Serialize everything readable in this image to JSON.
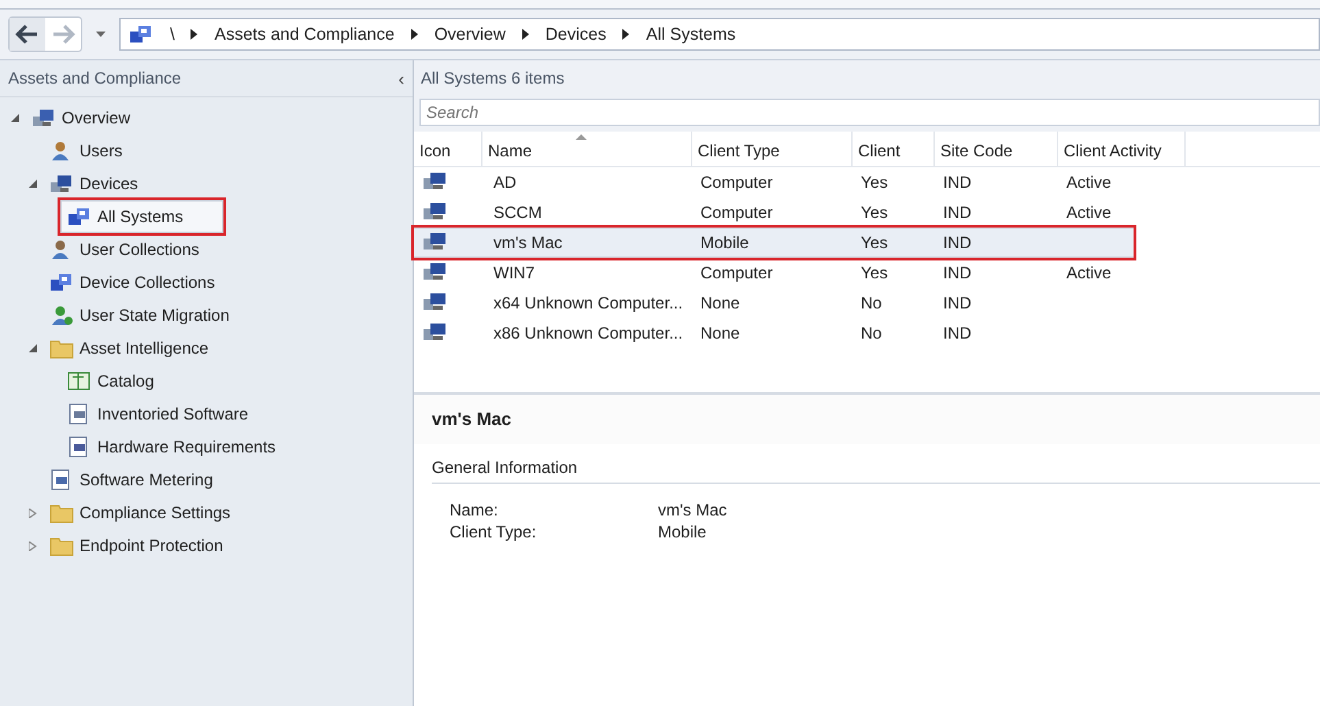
{
  "breadcrumb": [
    "\\",
    "Assets and Compliance",
    "Overview",
    "Devices",
    "All Systems"
  ],
  "sidebar": {
    "title": "Assets and Compliance",
    "collapse_glyph": "‹",
    "tree": [
      {
        "label": "Overview",
        "kind": "overview",
        "expanded": true,
        "selected": false,
        "highlighted": false,
        "children": [
          {
            "label": "Users",
            "kind": "user",
            "selected": false,
            "highlighted": false
          },
          {
            "label": "Devices",
            "kind": "devices",
            "expanded": true,
            "selected": false,
            "highlighted": false,
            "children": [
              {
                "label": "All Systems",
                "kind": "collection",
                "selected": true,
                "highlighted": true
              }
            ]
          },
          {
            "label": "User Collections",
            "kind": "user-collection",
            "selected": false,
            "highlighted": false
          },
          {
            "label": "Device Collections",
            "kind": "collection",
            "selected": false,
            "highlighted": false
          },
          {
            "label": "User State Migration",
            "kind": "migration",
            "selected": false,
            "highlighted": false
          },
          {
            "label": "Asset Intelligence",
            "kind": "folder",
            "expanded": true,
            "selected": false,
            "highlighted": false,
            "children": [
              {
                "label": "Catalog",
                "kind": "catalog",
                "selected": false,
                "highlighted": false
              },
              {
                "label": "Inventoried Software",
                "kind": "software",
                "selected": false,
                "highlighted": false
              },
              {
                "label": "Hardware Requirements",
                "kind": "hardware",
                "selected": false,
                "highlighted": false
              }
            ]
          },
          {
            "label": "Software Metering",
            "kind": "metering",
            "selected": false,
            "highlighted": false
          },
          {
            "label": "Compliance Settings",
            "kind": "folder",
            "expanded": false,
            "selected": false,
            "highlighted": false
          },
          {
            "label": "Endpoint Protection",
            "kind": "folder",
            "expanded": false,
            "selected": false,
            "highlighted": false
          }
        ]
      }
    ]
  },
  "list": {
    "title": "All Systems 6 items",
    "search": {
      "placeholder": "Search"
    },
    "columns": [
      "Icon",
      "Name",
      "Client Type",
      "Client",
      "Site Code",
      "Client Activity"
    ],
    "rows": [
      {
        "name": "AD",
        "client_type": "Computer",
        "client": "Yes",
        "site_code": "IND",
        "client_activity": "Active",
        "selected": false,
        "highlighted": false
      },
      {
        "name": "SCCM",
        "client_type": "Computer",
        "client": "Yes",
        "site_code": "IND",
        "client_activity": "Active",
        "selected": false,
        "highlighted": false
      },
      {
        "name": "vm's Mac",
        "client_type": "Mobile",
        "client": "Yes",
        "site_code": "IND",
        "selected": true,
        "highlighted": true
      },
      {
        "name": "WIN7",
        "client_type": "Computer",
        "client": "Yes",
        "site_code": "IND",
        "client_activity": "Active",
        "selected": false,
        "highlighted": false
      },
      {
        "name": "x64 Unknown Computer...",
        "client_type": "None",
        "client": "No",
        "site_code": "IND",
        "selected": false,
        "highlighted": false
      },
      {
        "name": "x86 Unknown Computer...",
        "client_type": "None",
        "client": "No",
        "site_code": "IND",
        "selected": false,
        "highlighted": false
      }
    ]
  },
  "details": {
    "title": "vm's Mac",
    "section": "General Information",
    "fields": [
      {
        "label": "Name:",
        "value": "vm's Mac"
      },
      {
        "label": "Client Type:",
        "value": "Mobile"
      }
    ]
  }
}
